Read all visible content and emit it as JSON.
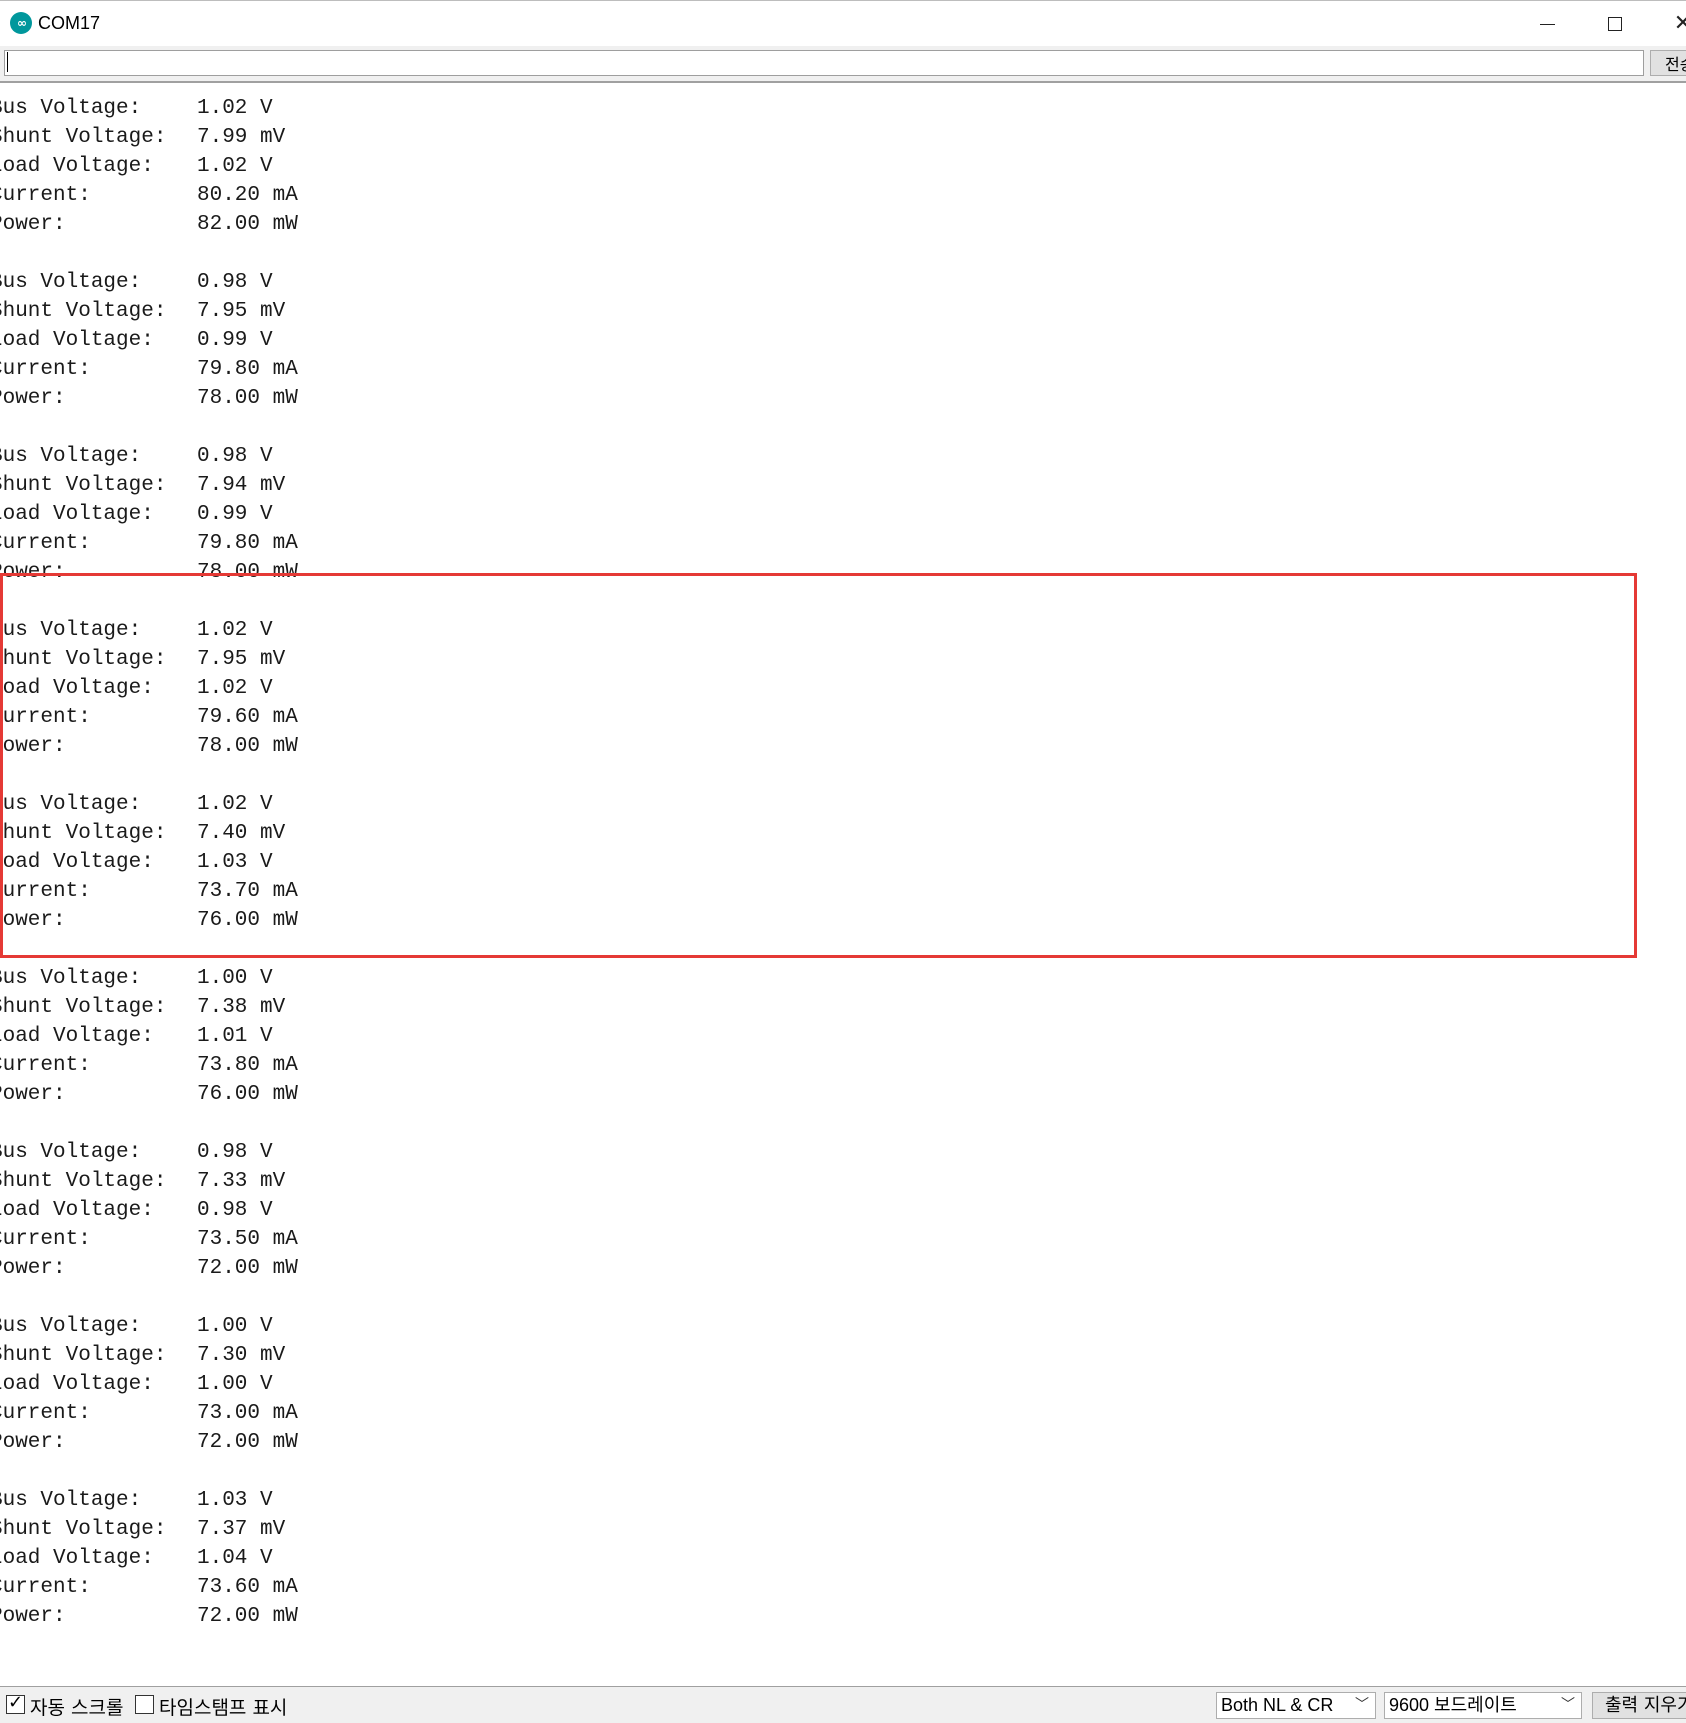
{
  "window": {
    "title": "COM17",
    "icon": "arduino-icon",
    "controls": [
      "minimize-icon",
      "maximize-icon",
      "close-icon"
    ]
  },
  "input_row": {
    "value": "",
    "send_label": "전송"
  },
  "output": {
    "lines": [
      {
        "label": "Bus Voltage:",
        "value": "1.02 V"
      },
      {
        "label": "Shunt Voltage:",
        "value": "7.99 mV"
      },
      {
        "label": "Load Voltage:",
        "value": "1.02 V"
      },
      {
        "label": "Current:",
        "value": "80.20 mA"
      },
      {
        "label": "Power:",
        "value": "82.00 mW"
      },
      {
        "label": "",
        "value": ""
      },
      {
        "label": "Bus Voltage:",
        "value": "0.98 V"
      },
      {
        "label": "Shunt Voltage:",
        "value": "7.95 mV"
      },
      {
        "label": "Load Voltage:",
        "value": "0.99 V"
      },
      {
        "label": "Current:",
        "value": "79.80 mA"
      },
      {
        "label": "Power:",
        "value": "78.00 mW"
      },
      {
        "label": "",
        "value": ""
      },
      {
        "label": "Bus Voltage:",
        "value": "0.98 V"
      },
      {
        "label": "Shunt Voltage:",
        "value": "7.94 mV"
      },
      {
        "label": "Load Voltage:",
        "value": "0.99 V"
      },
      {
        "label": "Current:",
        "value": "79.80 mA"
      },
      {
        "label": "Power:",
        "value": "78.00 mW"
      },
      {
        "label": "",
        "value": ""
      },
      {
        "label": "Bus Voltage:",
        "value": "1.02 V"
      },
      {
        "label": "Shunt Voltage:",
        "value": "7.95 mV"
      },
      {
        "label": "Load Voltage:",
        "value": "1.02 V"
      },
      {
        "label": "Current:",
        "value": "79.60 mA"
      },
      {
        "label": "Power:",
        "value": "78.00 mW"
      },
      {
        "label": "",
        "value": ""
      },
      {
        "label": "Bus Voltage:",
        "value": "1.02 V"
      },
      {
        "label": "Shunt Voltage:",
        "value": "7.40 mV"
      },
      {
        "label": "Load Voltage:",
        "value": "1.03 V"
      },
      {
        "label": "Current:",
        "value": "73.70 mA"
      },
      {
        "label": "Power:",
        "value": "76.00 mW"
      },
      {
        "label": "",
        "value": ""
      },
      {
        "label": "Bus Voltage:",
        "value": "1.00 V"
      },
      {
        "label": "Shunt Voltage:",
        "value": "7.38 mV"
      },
      {
        "label": "Load Voltage:",
        "value": "1.01 V"
      },
      {
        "label": "Current:",
        "value": "73.80 mA"
      },
      {
        "label": "Power:",
        "value": "76.00 mW"
      },
      {
        "label": "",
        "value": ""
      },
      {
        "label": "Bus Voltage:",
        "value": "0.98 V"
      },
      {
        "label": "Shunt Voltage:",
        "value": "7.33 mV"
      },
      {
        "label": "Load Voltage:",
        "value": "0.98 V"
      },
      {
        "label": "Current:",
        "value": "73.50 mA"
      },
      {
        "label": "Power:",
        "value": "72.00 mW"
      },
      {
        "label": "",
        "value": ""
      },
      {
        "label": "Bus Voltage:",
        "value": "1.00 V"
      },
      {
        "label": "Shunt Voltage:",
        "value": "7.30 mV"
      },
      {
        "label": "Load Voltage:",
        "value": "1.00 V"
      },
      {
        "label": "Current:",
        "value": "73.00 mA"
      },
      {
        "label": "Power:",
        "value": "72.00 mW"
      },
      {
        "label": "",
        "value": ""
      },
      {
        "label": "Bus Voltage:",
        "value": "1.03 V"
      },
      {
        "label": "Shunt Voltage:",
        "value": "7.37 mV"
      },
      {
        "label": "Load Voltage:",
        "value": "1.04 V"
      },
      {
        "label": "Current:",
        "value": "73.60 mA"
      },
      {
        "label": "Power:",
        "value": "72.00 mW"
      }
    ],
    "highlight_color": "#e53935"
  },
  "bottom_bar": {
    "autoscroll_label": "자동 스크롤",
    "autoscroll_checked": true,
    "timestamp_label": "타임스탬프 표시",
    "timestamp_checked": false,
    "line_ending_value": "Both NL & CR",
    "baud_rate_value": "9600 보드레이트",
    "clear_output_label": "출력 지우기"
  },
  "colors": {
    "arduino_teal": "#00979c",
    "background": "#ffffff",
    "toolbar": "#f0f0f0"
  }
}
